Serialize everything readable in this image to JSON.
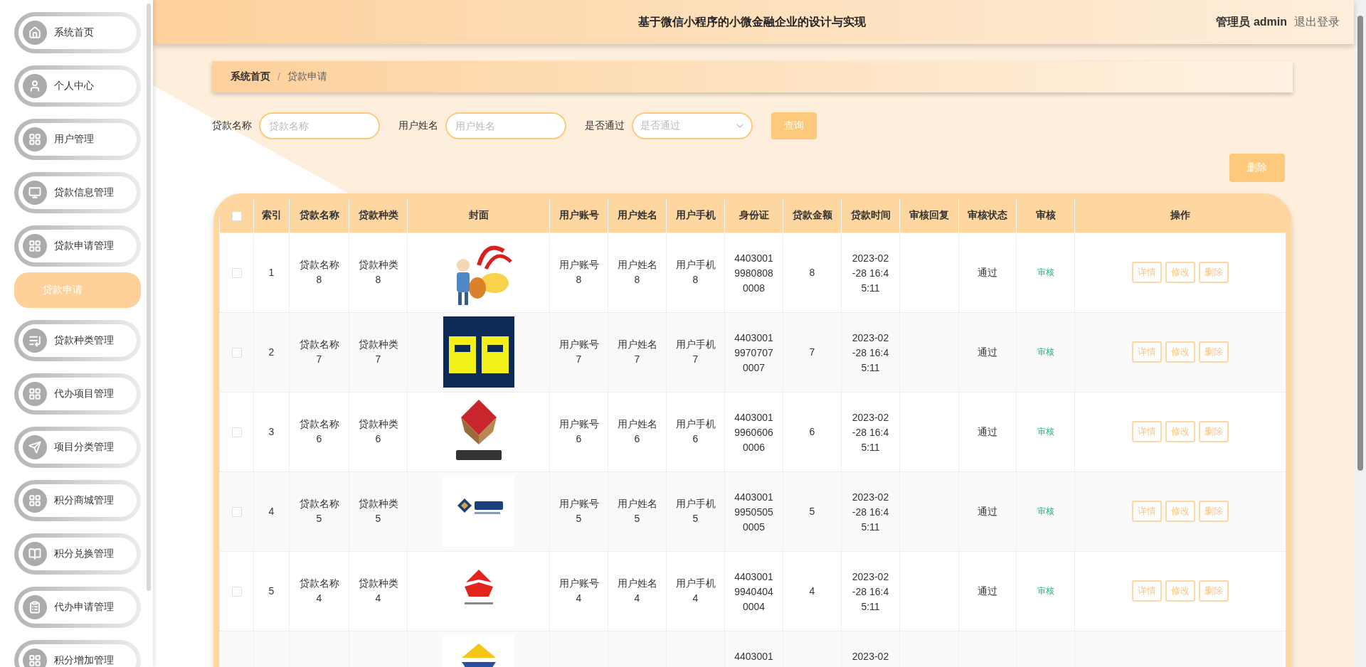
{
  "sidebar": {
    "items": [
      {
        "label": "系统首页",
        "selected": false
      },
      {
        "label": "个人中心",
        "selected": false
      },
      {
        "label": "用户管理",
        "selected": false
      },
      {
        "label": "贷款信息管理",
        "selected": false
      },
      {
        "label": "贷款申请管理",
        "selected": false,
        "children": [
          {
            "label": "贷款申请",
            "selected": true
          }
        ]
      },
      {
        "label": "贷款种类管理",
        "selected": false
      },
      {
        "label": "代办项目管理",
        "selected": false
      },
      {
        "label": "项目分类管理",
        "selected": false
      },
      {
        "label": "积分商城管理",
        "selected": false
      },
      {
        "label": "积分兑换管理",
        "selected": false
      },
      {
        "label": "代办申请管理",
        "selected": false
      },
      {
        "label": "积分增加管理",
        "selected": false
      }
    ]
  },
  "header": {
    "title": "基于微信小程序的小微金融企业的设计与实现",
    "user": "管理员 admin",
    "logout": "退出登录"
  },
  "breadcrumb": {
    "items": [
      "系统首页",
      "贷款申请"
    ],
    "separator": "/"
  },
  "search": {
    "fields": [
      {
        "kind": "text",
        "label": "贷款名称",
        "placeholder": "贷款名称"
      },
      {
        "kind": "text",
        "label": "用户姓名",
        "placeholder": "用户姓名"
      },
      {
        "kind": "select",
        "label": "是否通过",
        "placeholder": "是否通过"
      }
    ],
    "button": "查询"
  },
  "delete_button": "删除",
  "table": {
    "select_all_checked": false,
    "columns": [
      "索引",
      "贷款名称",
      "贷款种类",
      "封面",
      "用户账号",
      "用户姓名",
      "用户手机",
      "身份证",
      "贷款金额",
      "贷款时间",
      "审核回复",
      "审核状态",
      "审核",
      "操作"
    ],
    "rows": [
      {
        "checked": false,
        "index": "1",
        "name": "贷款名称8",
        "type": "贷款种类8",
        "account": "用户账号8",
        "username": "用户姓名8",
        "phone": "用户手机8",
        "id_card": "440300199808080008",
        "amount": "8",
        "time": "2023-02-28 16:45:11",
        "status": "通过",
        "review": "审核",
        "actions": [
          "详情",
          "修改",
          "删除"
        ]
      },
      {
        "checked": false,
        "index": "2",
        "name": "贷款名称7",
        "type": "贷款种类7",
        "account": "用户账号7",
        "username": "用户姓名7",
        "phone": "用户手机7",
        "id_card": "440300199707070007",
        "amount": "7",
        "time": "2023-02-28 16:45:11",
        "status": "通过",
        "review": "审核",
        "actions": [
          "详情",
          "修改",
          "删除"
        ]
      },
      {
        "checked": false,
        "index": "3",
        "name": "贷款名称6",
        "type": "贷款种类6",
        "account": "用户账号6",
        "username": "用户姓名6",
        "phone": "用户手机6",
        "id_card": "440300199606060006",
        "amount": "6",
        "time": "2023-02-28 16:45:11",
        "status": "通过",
        "review": "审核",
        "actions": [
          "详情",
          "修改",
          "删除"
        ]
      },
      {
        "checked": false,
        "index": "4",
        "name": "贷款名称5",
        "type": "贷款种类5",
        "account": "用户账号5",
        "username": "用户姓名5",
        "phone": "用户手机5",
        "id_card": "440300199505050005",
        "amount": "5",
        "time": "2023-02-28 16:45:11",
        "status": "通过",
        "review": "审核",
        "actions": [
          "详情",
          "修改",
          "删除"
        ]
      },
      {
        "checked": false,
        "index": "5",
        "name": "贷款名称4",
        "type": "贷款种类4",
        "account": "用户账号4",
        "username": "用户姓名4",
        "phone": "用户手机4",
        "id_card": "440300199404040004",
        "amount": "4",
        "time": "2023-02-28 16:45:11",
        "status": "通过",
        "review": "审核",
        "actions": [
          "详情",
          "修改",
          "删除"
        ]
      },
      {
        "id_card": "4403001",
        "time": "2023-02"
      }
    ]
  }
}
